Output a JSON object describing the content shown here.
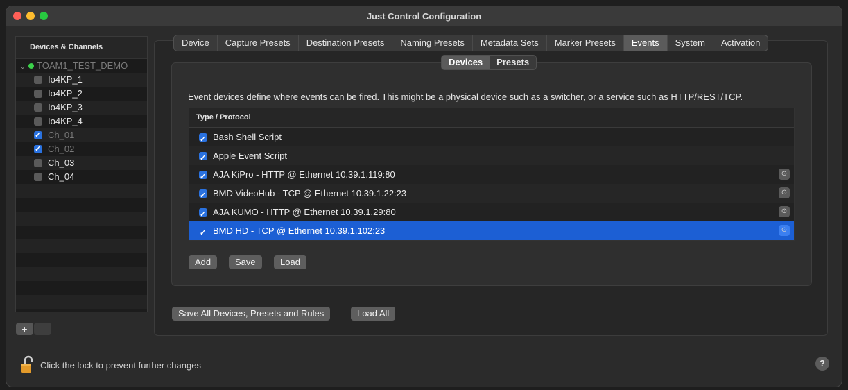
{
  "window": {
    "title": "Just Control Configuration"
  },
  "sidebar": {
    "header": "Devices & Channels",
    "root": {
      "label": "TOAM1_TEST_DEMO",
      "status_color": "#3bd14a"
    },
    "items": [
      {
        "label": "Io4KP_1",
        "checked": false,
        "dim": false
      },
      {
        "label": "Io4KP_2",
        "checked": false,
        "dim": false
      },
      {
        "label": "Io4KP_3",
        "checked": false,
        "dim": false
      },
      {
        "label": "Io4KP_4",
        "checked": false,
        "dim": false
      },
      {
        "label": "Ch_01",
        "checked": true,
        "dim": true
      },
      {
        "label": "Ch_02",
        "checked": true,
        "dim": true
      },
      {
        "label": "Ch_03",
        "checked": false,
        "dim": false
      },
      {
        "label": "Ch_04",
        "checked": false,
        "dim": false
      }
    ],
    "add_label": "+",
    "remove_label": "—"
  },
  "tabs": [
    {
      "label": "Device",
      "active": false
    },
    {
      "label": "Capture Presets",
      "active": false
    },
    {
      "label": "Destination Presets",
      "active": false
    },
    {
      "label": "Naming Presets",
      "active": false
    },
    {
      "label": "Metadata Sets",
      "active": false
    },
    {
      "label": "Marker Presets",
      "active": false
    },
    {
      "label": "Events",
      "active": true
    },
    {
      "label": "System",
      "active": false
    },
    {
      "label": "Activation",
      "active": false
    }
  ],
  "subtabs": [
    {
      "label": "Devices",
      "active": true
    },
    {
      "label": "Presets",
      "active": false
    }
  ],
  "events": {
    "description": "Event devices define where events can be fired. This might be a physical device such as a switcher, or a service such as HTTP/REST/TCP.",
    "column_header": "Type / Protocol",
    "rows": [
      {
        "label": "Bash Shell Script",
        "checked": true,
        "has_settings": false,
        "selected": false
      },
      {
        "label": "Apple Event Script",
        "checked": true,
        "has_settings": false,
        "selected": false
      },
      {
        "label": "AJA KiPro - HTTP @ Ethernet 10.39.1.119:80",
        "checked": true,
        "has_settings": true,
        "selected": false
      },
      {
        "label": "BMD VideoHub - TCP @ Ethernet 10.39.1.22:23",
        "checked": true,
        "has_settings": true,
        "selected": false
      },
      {
        "label": "AJA KUMO - HTTP @ Ethernet 10.39.1.29:80",
        "checked": true,
        "has_settings": true,
        "selected": false
      },
      {
        "label": "BMD HD - TCP @ Ethernet 10.39.1.102:23",
        "checked": true,
        "has_settings": true,
        "selected": true
      }
    ],
    "buttons": {
      "add": "Add",
      "save": "Save",
      "load": "Load"
    }
  },
  "footer": {
    "save_all": "Save All Devices, Presets and Rules",
    "load_all": "Load All",
    "lock_text": "Click the lock to prevent further changes",
    "help": "?"
  },
  "colors": {
    "accent": "#1c5fd4",
    "checkbox": "#2a72e0",
    "lock": "#e39a2a"
  }
}
